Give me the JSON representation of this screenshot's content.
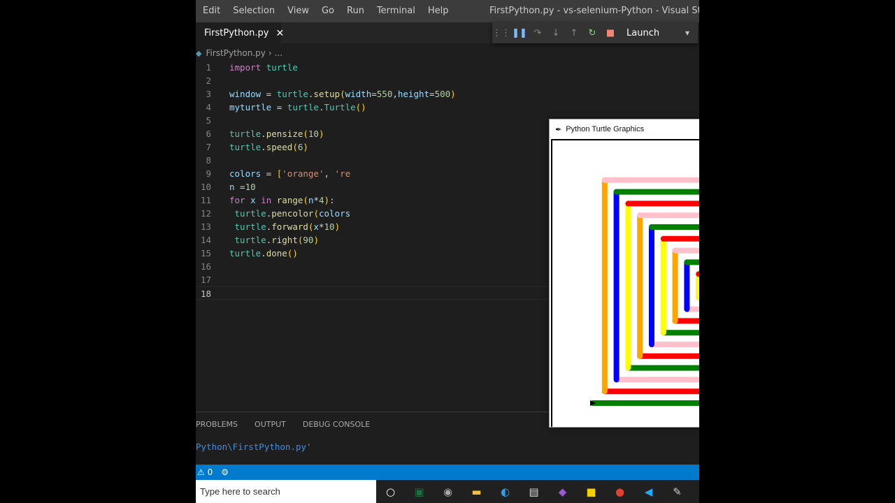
{
  "menu": [
    "Edit",
    "Selection",
    "View",
    "Go",
    "Run",
    "Terminal",
    "Help"
  ],
  "window_title": "FirstPython.py - vs-selenium-Python - Visual Studio Code",
  "tab": {
    "label": "FirstPython.py",
    "close": "✕"
  },
  "debug": {
    "config": "Launch"
  },
  "breadcrumb": {
    "file": "FirstPython.py",
    "rest": "..."
  },
  "code_lines": [
    "import turtle",
    "",
    "window = turtle.setup(width=550,height=500)",
    "myturtle = turtle.Turtle()",
    "",
    "turtle.pensize(10)",
    "turtle.speed(6)",
    "",
    "colors = ['orange', 're",
    "n =10",
    "for x in range(n*4):",
    " turtle.pencolor(colors",
    " turtle.forward(x*10)",
    " turtle.right(90)",
    "turtle.done()",
    "",
    "",
    ""
  ],
  "panel": {
    "tabs": [
      "PROBLEMS",
      "OUTPUT",
      "DEBUG CONSOLE"
    ],
    "terminal_text": "Python\\FirstPython.py'"
  },
  "status": {
    "errors": "0"
  },
  "taskbar": {
    "search_placeholder": "Type here to search"
  },
  "turtle_window": {
    "title": "Python Turtle Graphics"
  },
  "spiral": {
    "colors": [
      "orange",
      "pink",
      "blue",
      "green",
      "yellow",
      "red"
    ]
  },
  "colors": {
    "menubar": "#3c3c3c",
    "editor_bg": "#1e1e1e",
    "statusbar": "#007acc",
    "taskbar": "#202020"
  }
}
